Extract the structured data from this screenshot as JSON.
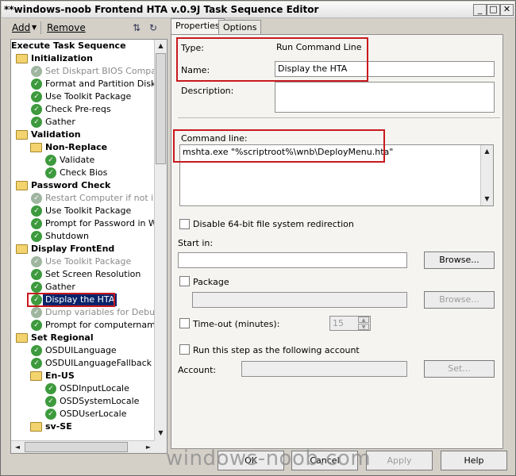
{
  "window": {
    "title": "**windows-noob Frontend HTA v.0.9J Task Sequence Editor",
    "minimize": "_",
    "maximize": "□",
    "close": "✕"
  },
  "toolbar": {
    "add_label": "Add",
    "remove_label": "Remove",
    "icons": [
      "move-up-icon",
      "move-down-icon"
    ]
  },
  "tree": {
    "items": [
      {
        "label": "Execute Task Sequence",
        "bold": true,
        "icon": "none",
        "level": 0
      },
      {
        "label": "Initialization",
        "bold": true,
        "icon": "folder",
        "level": 1
      },
      {
        "label": "Set Diskpart BIOS Compatibi",
        "icon": "check",
        "gray": true,
        "level": 2
      },
      {
        "label": "Format and Partition Disk",
        "icon": "check",
        "level": 2
      },
      {
        "label": "Use Toolkit Package",
        "icon": "check",
        "level": 2
      },
      {
        "label": "Check Pre-reqs",
        "icon": "check",
        "level": 2
      },
      {
        "label": "Gather",
        "icon": "check",
        "level": 2
      },
      {
        "label": "Validation",
        "bold": true,
        "icon": "folder",
        "level": 1
      },
      {
        "label": "Non-Replace",
        "bold": true,
        "icon": "folder",
        "level": 2
      },
      {
        "label": "Validate",
        "icon": "check",
        "level": 3
      },
      {
        "label": "Check Bios",
        "icon": "check",
        "level": 3
      },
      {
        "label": "Password Check",
        "bold": true,
        "icon": "folder",
        "level": 1
      },
      {
        "label": "Restart Computer if not in W",
        "icon": "check",
        "gray": true,
        "level": 2
      },
      {
        "label": "Use Toolkit Package",
        "icon": "check",
        "level": 2
      },
      {
        "label": "Prompt for Password in WinF",
        "icon": "check",
        "level": 2
      },
      {
        "label": "Shutdown",
        "icon": "check",
        "level": 2
      },
      {
        "label": "Display FrontEnd",
        "bold": true,
        "icon": "folder",
        "level": 1
      },
      {
        "label": "Use Toolkit Package",
        "icon": "check",
        "gray": true,
        "level": 2
      },
      {
        "label": "Set Screen Resolution",
        "icon": "check",
        "level": 2
      },
      {
        "label": "Gather",
        "icon": "check",
        "level": 2
      },
      {
        "label": "Display the HTA",
        "icon": "check",
        "selected": true,
        "level": 2
      },
      {
        "label": "Dump variables for Debuggin",
        "icon": "check",
        "gray": true,
        "level": 2
      },
      {
        "label": "Prompt for computername if",
        "icon": "check",
        "level": 2
      },
      {
        "label": "Set Regional",
        "bold": true,
        "icon": "folder",
        "level": 1
      },
      {
        "label": "OSDUILanguage",
        "icon": "check",
        "level": 2
      },
      {
        "label": "OSDUILanguageFallback",
        "icon": "check",
        "level": 2
      },
      {
        "label": "En-US",
        "bold": true,
        "icon": "folder",
        "level": 2
      },
      {
        "label": "OSDInputLocale",
        "icon": "check",
        "level": 3
      },
      {
        "label": "OSDSystemLocale",
        "icon": "check",
        "level": 3
      },
      {
        "label": "OSDUserLocale",
        "icon": "check",
        "level": 3
      },
      {
        "label": "sv-SE",
        "bold": true,
        "icon": "folder",
        "level": 2
      }
    ]
  },
  "tabs": [
    {
      "label": "Properties",
      "active": true
    },
    {
      "label": "Options",
      "active": false
    }
  ],
  "properties": {
    "type_label": "Type:",
    "type_value": "Run Command Line",
    "name_label": "Name:",
    "name_value": "Display the HTA",
    "description_label": "Description:",
    "description_value": "",
    "command_line_label": "Command line:",
    "command_line_value": "mshta.exe \"%scriptroot%\\wnb\\DeployMenu.hta\"",
    "disable_64bit_label": "Disable 64-bit file system redirection",
    "start_in_label": "Start in:",
    "start_in_value": "",
    "browse_label": "Browse...",
    "package_label": "Package",
    "package_value": "",
    "browse2_label": "Browse...",
    "timeout_label": "Time-out (minutes):",
    "timeout_value": "15",
    "run_as_label": "Run this step as the following account",
    "account_label": "Account:",
    "account_value": "",
    "set_label": "Set..."
  },
  "footer": {
    "ok_label": "OK",
    "cancel_label": "Cancel",
    "apply_label": "Apply",
    "help_label": "Help"
  },
  "watermark": "windows-noob.com",
  "colors": {
    "highlight": "#c8191e",
    "selection": "#0a246a",
    "check": "#3d9a3d",
    "folder": "#f3d36d"
  }
}
